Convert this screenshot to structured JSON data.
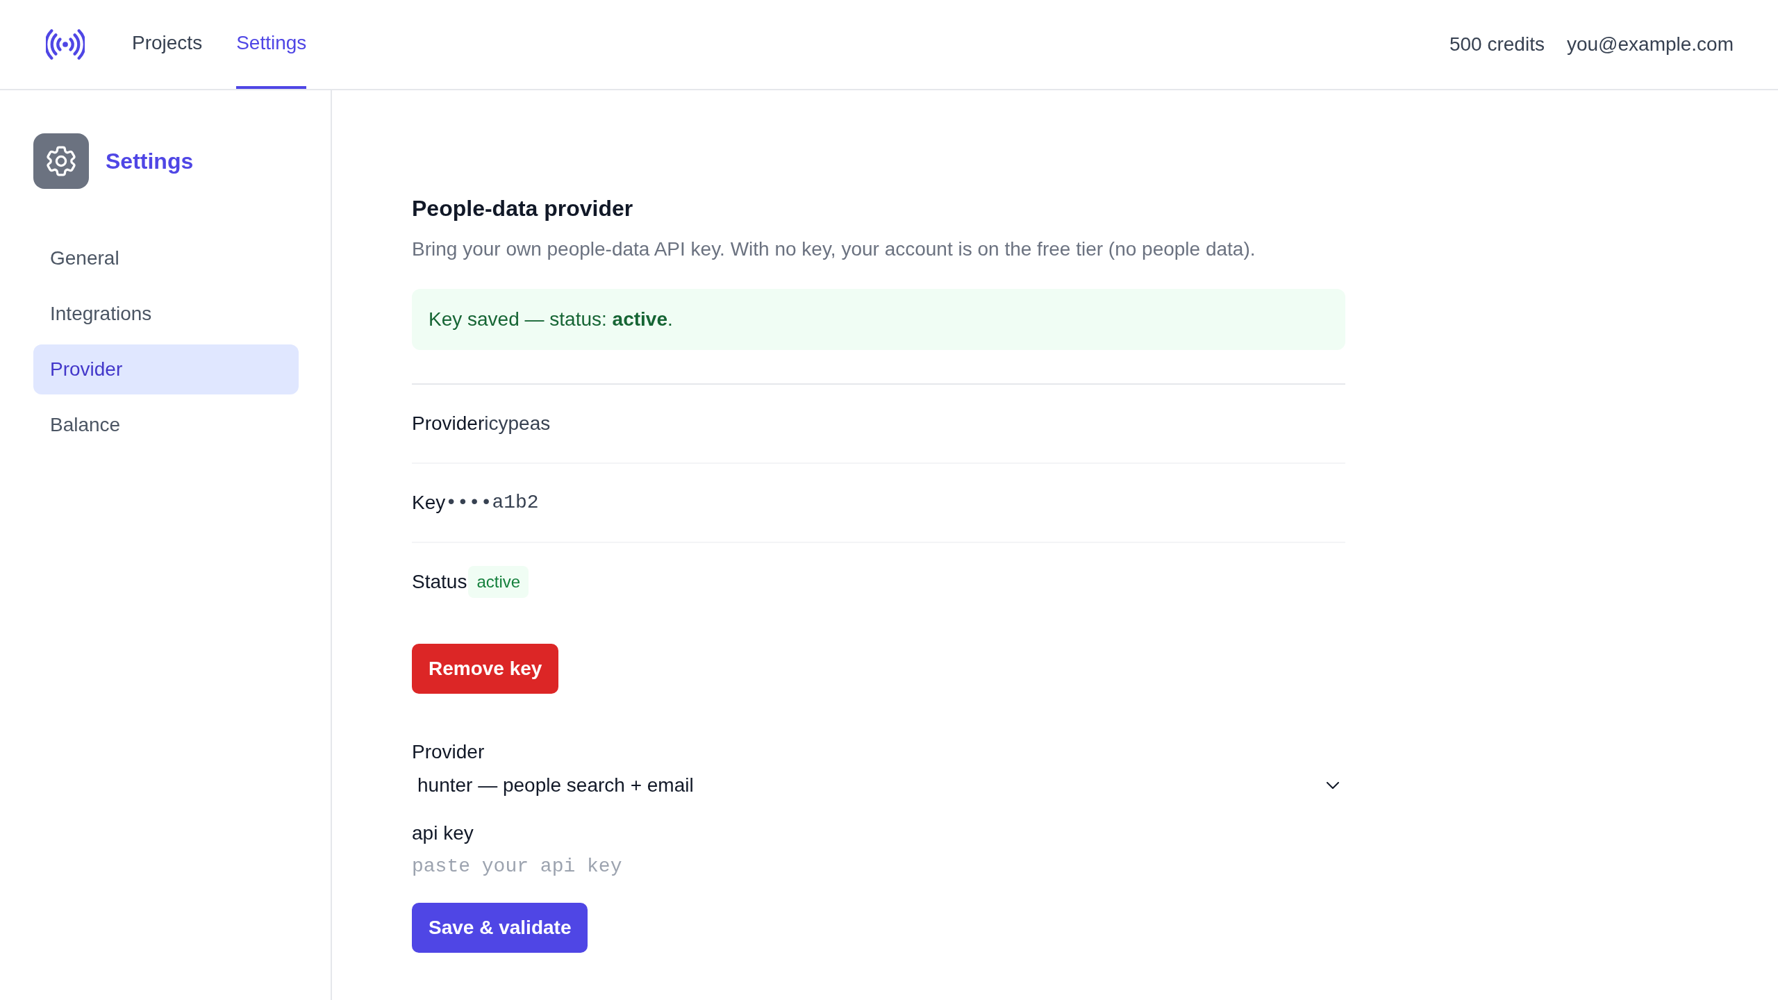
{
  "header": {
    "nav": [
      {
        "label": "Projects",
        "selected": false
      },
      {
        "label": "Settings",
        "selected": true
      }
    ],
    "credits": "500 credits",
    "account_email": "you@example.com"
  },
  "sidebar": {
    "title": "Settings",
    "items": [
      {
        "label": "General",
        "selected": false
      },
      {
        "label": "Integrations",
        "selected": false
      },
      {
        "label": "Provider",
        "selected": true
      },
      {
        "label": "Balance",
        "selected": false
      }
    ]
  },
  "provider_section": {
    "title": "People-data provider",
    "description": "Bring your own people-data API key. With no key, your account is on the free tier (no people data).",
    "alert": "Key saved — status: **active**.",
    "details": [
      {
        "kind": "text",
        "label": "Provider",
        "value": "icypeas"
      },
      {
        "kind": "mono",
        "label": "Key",
        "value": "••••a1b2"
      },
      {
        "kind": "badge",
        "label": "Status",
        "value": "active"
      }
    ],
    "remove_button": "Remove key",
    "form": {
      "provider_label": "Provider",
      "provider_select": {
        "value": "hunter — people search + email"
      },
      "api_key_label": "api key",
      "api_key_field": {
        "placeholder": "paste your api key"
      },
      "submit_button": "Save & validate"
    }
  }
}
